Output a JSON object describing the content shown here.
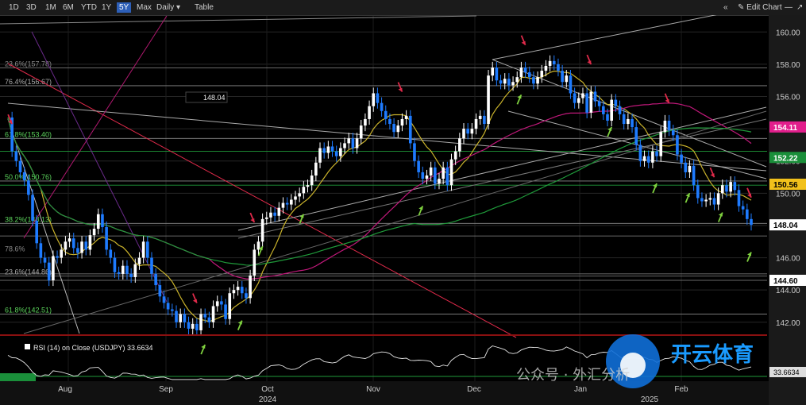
{
  "toolbar": {
    "ranges": [
      "1D",
      "3D",
      "1M",
      "6M",
      "YTD",
      "1Y",
      "5Y",
      "Max"
    ],
    "active_range": "5Y",
    "interval": "Daily",
    "table_label": "Table",
    "edit_label": "Edit Chart",
    "collapse_glyph": "«",
    "edit_glyph": "✎",
    "win_glyph_1": "—",
    "win_glyph_2": "↗"
  },
  "rsi_label": "RSI (14)  on Close (USDJPY) 33.6634",
  "crosshair_label": "148.04",
  "watermark": {
    "cn_text": "开云体育",
    "sub_text": "公众号 · 外汇分析"
  },
  "fib_labels": [
    "23.6%(157.78)",
    "76.4%(156.67)",
    "61.8%(153.40)",
    "50.0%(150.76)",
    "38.2%(148.13)",
    "78.6%",
    "23.6%(144.86)",
    "61.8%(142.51)"
  ],
  "colors": {
    "bg": "#000000",
    "up": "#ffffff",
    "down": "#1e7bff",
    "sma_short": "#c9b22b",
    "sma_mid": "#c0187a",
    "sma_long": "#1f9a3a",
    "rsi": "#e6e6e6",
    "marker_down": "#e02a4a",
    "marker_up": "#7fd13f",
    "price_last": "#ffffff",
    "badge_magenta": "#e21e8c",
    "badge_green": "#1a8f3a",
    "badge_yellow": "#f2c11b"
  },
  "chart_data": {
    "type": "candlestick",
    "instrument": "USDJPY",
    "x_labels": [
      "Aug",
      "Sep",
      "Oct",
      "Nov",
      "Dec",
      "Jan",
      "Feb"
    ],
    "year_labels": [
      "2024",
      "2025"
    ],
    "y_ticks": [
      142,
      144,
      146,
      148,
      150,
      152,
      154,
      156,
      158,
      160
    ],
    "ylim": [
      141.3,
      161.0
    ],
    "price_badges": [
      {
        "label": "154.11",
        "value": 154.11,
        "color": "#e21e8c"
      },
      {
        "label": "152.22",
        "value": 152.22,
        "color": "#1a8f3a"
      },
      {
        "label": "150.56",
        "value": 150.56,
        "color": "#f2c11b"
      },
      {
        "label": "148.04",
        "value": 148.04,
        "color": "#ffffff"
      },
      {
        "label": "144.60",
        "value": 144.6,
        "color": "#ffffff"
      }
    ],
    "rsi_badge": {
      "label": "33.6634",
      "value": 33.6634
    },
    "horizontal_levels": [
      157.78,
      156.67,
      153.4,
      150.76,
      148.13,
      147.35,
      145.0,
      144.86,
      144.6,
      142.51
    ],
    "closes": [
      154.7,
      152.6,
      152.0,
      151.3,
      150.8,
      149.9,
      148.3,
      146.9,
      146.0,
      145.7,
      144.6,
      146.1,
      146.0,
      146.5,
      147.0,
      147.2,
      146.6,
      146.3,
      147.0,
      146.5,
      147.4,
      147.8,
      148.7,
      147.9,
      146.5,
      146.0,
      145.1,
      145.0,
      145.5,
      145.0,
      144.8,
      145.6,
      146.0,
      147.0,
      146.0,
      145.0,
      144.3,
      143.6,
      143.2,
      142.8,
      142.7,
      142.0,
      142.5,
      142.0,
      141.6,
      141.9,
      141.5,
      142.5,
      142.3,
      142.0,
      143.0,
      143.3,
      143.1,
      142.2,
      143.8,
      144.0,
      144.2,
      143.8,
      143.5,
      144.9,
      146.5,
      147.0,
      148.4,
      148.5,
      148.8,
      148.6,
      149.1,
      149.4,
      149.3,
      149.6,
      149.8,
      150.0,
      150.4,
      150.5,
      151.1,
      151.9,
      152.8,
      152.5,
      152.9,
      152.6,
      152.3,
      152.8,
      153.1,
      153.4,
      152.8,
      153.4,
      154.2,
      154.6,
      155.4,
      156.2,
      155.6,
      155.1,
      154.6,
      154.3,
      153.8,
      154.2,
      154.6,
      154.8,
      153.1,
      152.0,
      151.3,
      150.9,
      151.1,
      151.6,
      150.6,
      150.9,
      151.6,
      150.5,
      152.1,
      152.6,
      153.4,
      154.0,
      153.7,
      154.0,
      154.6,
      154.8,
      154.3,
      157.3,
      157.8,
      157.0,
      156.8,
      157.1,
      156.7,
      156.9,
      157.2,
      157.8,
      157.5,
      157.2,
      156.8,
      157.2,
      157.6,
      157.9,
      158.2,
      158.0,
      157.6,
      156.9,
      157.3,
      156.2,
      155.6,
      155.9,
      156.2,
      155.0,
      156.3,
      155.7,
      155.4,
      154.9,
      154.5,
      155.8,
      155.4,
      154.9,
      154.3,
      154.6,
      154.1,
      153.0,
      152.0,
      152.3,
      151.9,
      152.6,
      152.3,
      153.8,
      154.5,
      153.9,
      153.6,
      152.4,
      151.9,
      151.3,
      151.7,
      150.5,
      149.7,
      149.5,
      149.6,
      149.7,
      149.3,
      150.0,
      150.5,
      150.1,
      150.7,
      150.2,
      149.2,
      149.0,
      148.4,
      148.04
    ]
  }
}
